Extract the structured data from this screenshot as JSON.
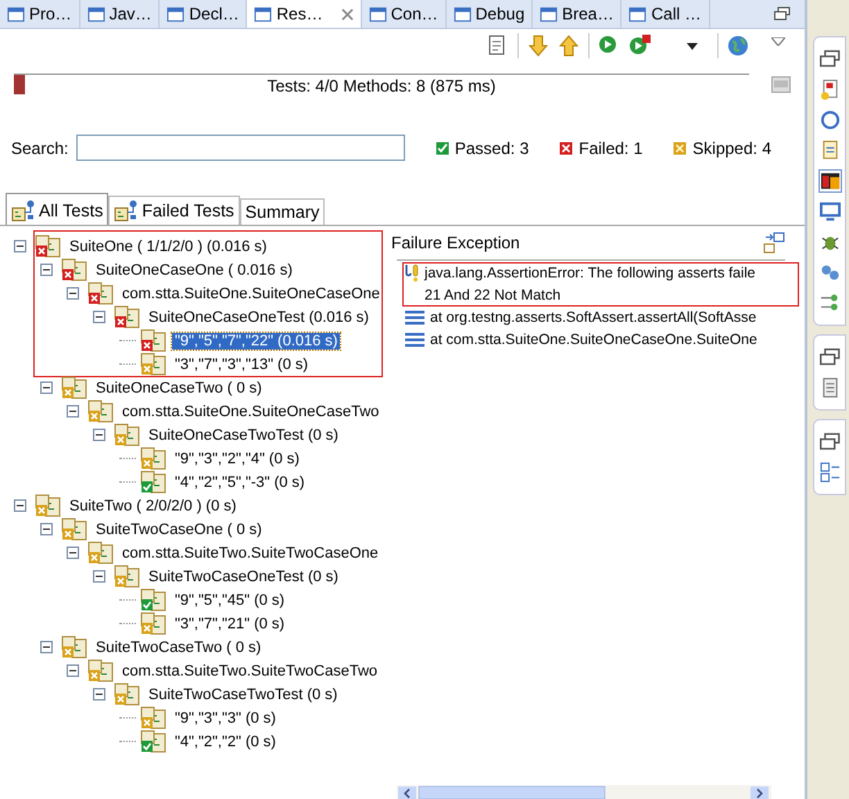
{
  "view_tabs": [
    {
      "label": "Pro…",
      "selected": false
    },
    {
      "label": "Jav…",
      "selected": false
    },
    {
      "label": "Decl…",
      "selected": false
    },
    {
      "label": "Res…",
      "selected": true
    },
    {
      "label": "Con…",
      "selected": false
    },
    {
      "label": "Debug",
      "selected": false
    },
    {
      "label": "Brea…",
      "selected": false
    },
    {
      "label": "Call …",
      "selected": false
    }
  ],
  "progress": {
    "level": 0.015,
    "failed": true,
    "summary": "Tests: 4/0  Methods: 8 (875 ms)"
  },
  "search": {
    "label": "Search:"
  },
  "counts": [
    {
      "kind": "passed",
      "label": "Passed: 3"
    },
    {
      "kind": "failed",
      "label": "Failed: 1"
    },
    {
      "kind": "skipped",
      "label": "Skipped: 4"
    }
  ],
  "result_tabs": [
    {
      "label": "All Tests",
      "selected": true,
      "icon": true
    },
    {
      "label": "Failed Tests",
      "selected": false,
      "icon": true
    },
    {
      "label": "Summary",
      "selected": false,
      "icon": false
    }
  ],
  "tree": [
    {
      "label": "SuiteOne ( 1/1/2/0 ) (0.016 s)",
      "kind": "failed",
      "expanded": true,
      "selected": false,
      "highlighted": true,
      "children": [
        {
          "label": "SuiteOneCaseOne ( 0.016 s)",
          "kind": "failed",
          "expanded": true,
          "selected": false,
          "highlighted": true,
          "children": [
            {
              "label": "com.stta.SuiteOne.SuiteOneCaseOne",
              "kind": "failed",
              "expanded": true,
              "selected": false,
              "highlighted": true,
              "children": [
                {
                  "label": "SuiteOneCaseOneTest  (0.016 s)",
                  "kind": "failed",
                  "expanded": true,
                  "selected": false,
                  "highlighted": true,
                  "children": [
                    {
                      "label": "\"9\",\"5\",\"7\",\"22\"  (0.016 s)",
                      "kind": "failed",
                      "selected": true,
                      "highlighted": true
                    },
                    {
                      "label": "\"3\",\"7\",\"3\",\"13\"  (0 s)",
                      "kind": "skipped",
                      "selected": false,
                      "highlighted": true
                    }
                  ]
                }
              ]
            }
          ]
        },
        {
          "label": "SuiteOneCaseTwo ( 0 s)",
          "kind": "skipped",
          "expanded": true,
          "selected": false,
          "highlighted": false,
          "children": [
            {
              "label": "com.stta.SuiteOne.SuiteOneCaseTwo",
              "kind": "skipped",
              "expanded": true,
              "selected": false,
              "highlighted": false,
              "children": [
                {
                  "label": "SuiteOneCaseTwoTest  (0 s)",
                  "kind": "skipped",
                  "expanded": true,
                  "selected": false,
                  "highlighted": false,
                  "children": [
                    {
                      "label": "\"9\",\"3\",\"2\",\"4\"  (0 s)",
                      "kind": "skipped",
                      "selected": false,
                      "highlighted": false
                    },
                    {
                      "label": "\"4\",\"2\",\"5\",\"-3\"  (0 s)",
                      "kind": "passed",
                      "selected": false,
                      "highlighted": false
                    }
                  ]
                }
              ]
            }
          ]
        }
      ]
    },
    {
      "label": "SuiteTwo ( 2/0/2/0 ) (0 s)",
      "kind": "skipped",
      "expanded": true,
      "selected": false,
      "highlighted": false,
      "children": [
        {
          "label": "SuiteTwoCaseOne ( 0 s)",
          "kind": "skipped",
          "expanded": true,
          "selected": false,
          "highlighted": false,
          "children": [
            {
              "label": "com.stta.SuiteTwo.SuiteTwoCaseOne",
              "kind": "skipped",
              "expanded": true,
              "selected": false,
              "highlighted": false,
              "children": [
                {
                  "label": "SuiteTwoCaseOneTest  (0 s)",
                  "kind": "skipped",
                  "expanded": true,
                  "selected": false,
                  "highlighted": false,
                  "children": [
                    {
                      "label": "\"9\",\"5\",\"45\"  (0 s)",
                      "kind": "passed",
                      "selected": false,
                      "highlighted": false
                    },
                    {
                      "label": "\"3\",\"7\",\"21\"  (0 s)",
                      "kind": "skipped",
                      "selected": false,
                      "highlighted": false
                    }
                  ]
                }
              ]
            }
          ]
        },
        {
          "label": "SuiteTwoCaseTwo ( 0 s)",
          "kind": "skipped",
          "expanded": true,
          "selected": false,
          "highlighted": false,
          "children": [
            {
              "label": "com.stta.SuiteTwo.SuiteTwoCaseTwo",
              "kind": "skipped",
              "expanded": true,
              "selected": false,
              "highlighted": false,
              "children": [
                {
                  "label": "SuiteTwoCaseTwoTest  (0 s)",
                  "kind": "skipped",
                  "expanded": true,
                  "selected": false,
                  "highlighted": false,
                  "children": [
                    {
                      "label": "\"9\",\"3\",\"3\"  (0 s)",
                      "kind": "skipped",
                      "selected": false,
                      "highlighted": false
                    },
                    {
                      "label": "\"4\",\"2\",\"2\"  (0 s)",
                      "kind": "passed",
                      "selected": false,
                      "highlighted": false
                    }
                  ]
                }
              ]
            }
          ]
        }
      ]
    }
  ],
  "failure": {
    "title": "Failure Exception",
    "lines": [
      {
        "kind": "message",
        "text": "java.lang.AssertionError: The following asserts faile",
        "highlighted": true
      },
      {
        "kind": "message",
        "text": "21 And 22 Not Match",
        "highlighted": true
      },
      {
        "kind": "stack",
        "text": "at org.testng.asserts.SoftAssert.assertAll(SoftAsse",
        "highlighted": false
      },
      {
        "kind": "stack",
        "text": "at com.stta.SuiteOne.SuiteOneCaseOne.SuiteOne",
        "highlighted": false
      }
    ]
  }
}
